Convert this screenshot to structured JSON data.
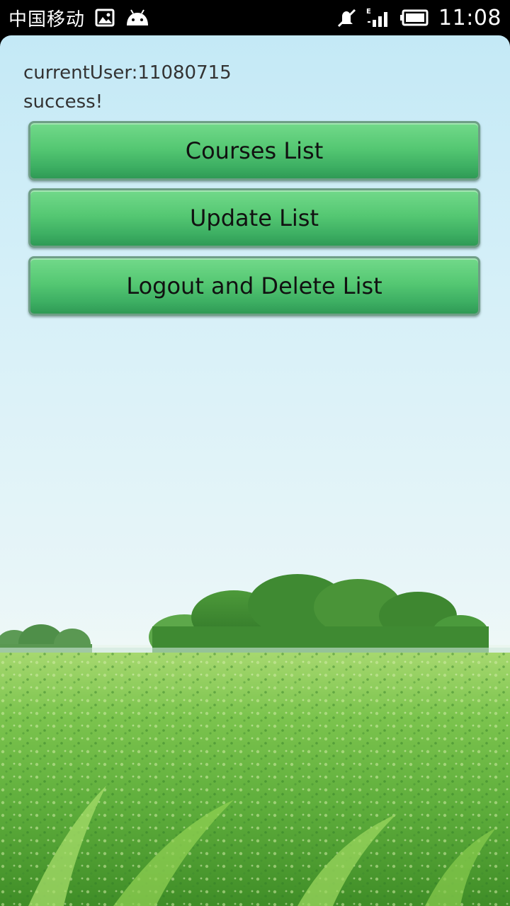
{
  "status_bar": {
    "carrier": "中国移动",
    "network_type": "E",
    "time": "11:08",
    "icons": [
      "image-notification-icon",
      "android-notification-icon",
      "muted-icon",
      "signal-icon",
      "battery-icon"
    ]
  },
  "app": {
    "current_user": "currentUser:11080715",
    "status_message": "success!",
    "buttons": {
      "courses": "Courses List",
      "update": "Update List",
      "logout": "Logout and Delete List"
    }
  },
  "colors": {
    "button_green": "#55c873",
    "sky": "#cdecf7",
    "grass": "#5fae3c"
  }
}
